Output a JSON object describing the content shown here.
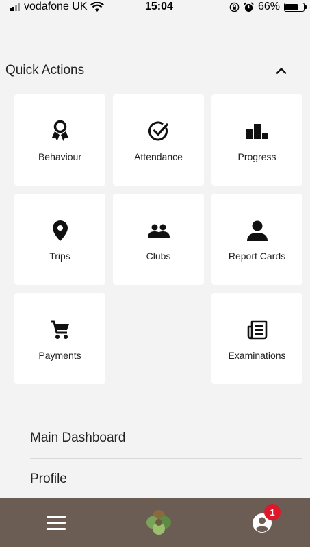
{
  "status_bar": {
    "carrier": "vodafone UK",
    "time": "15:04",
    "battery": "66%",
    "battery_level": 0.66,
    "signal_bars": 4,
    "icons": [
      "signal-icon",
      "wifi-icon",
      "orientation-lock-icon",
      "alarm-icon",
      "battery-icon"
    ]
  },
  "quick_actions": {
    "title": "Quick Actions",
    "collapse_icon": "chevron-up-icon",
    "tiles": [
      {
        "label": "Behaviour",
        "icon": "award-ribbon-icon"
      },
      {
        "label": "Attendance",
        "icon": "check-circle-icon"
      },
      {
        "label": "Progress",
        "icon": "podium-icon"
      },
      {
        "label": "Trips",
        "icon": "map-pin-icon"
      },
      {
        "label": "Clubs",
        "icon": "group-icon"
      },
      {
        "label": "Report Cards",
        "icon": "person-icon"
      },
      {
        "label": "Payments",
        "icon": "cart-icon"
      },
      {
        "label": "Examinations",
        "icon": "newspaper-icon"
      }
    ]
  },
  "menu": {
    "items": [
      {
        "label": "Main Dashboard"
      },
      {
        "label": "Profile"
      }
    ]
  },
  "bottom_bar": {
    "background": "#6b5d54",
    "menu_icon": "hamburger-icon",
    "logo": "app-logo",
    "account_icon": "account-icon",
    "notification_count": "1",
    "badge_color": "#e0162b"
  }
}
